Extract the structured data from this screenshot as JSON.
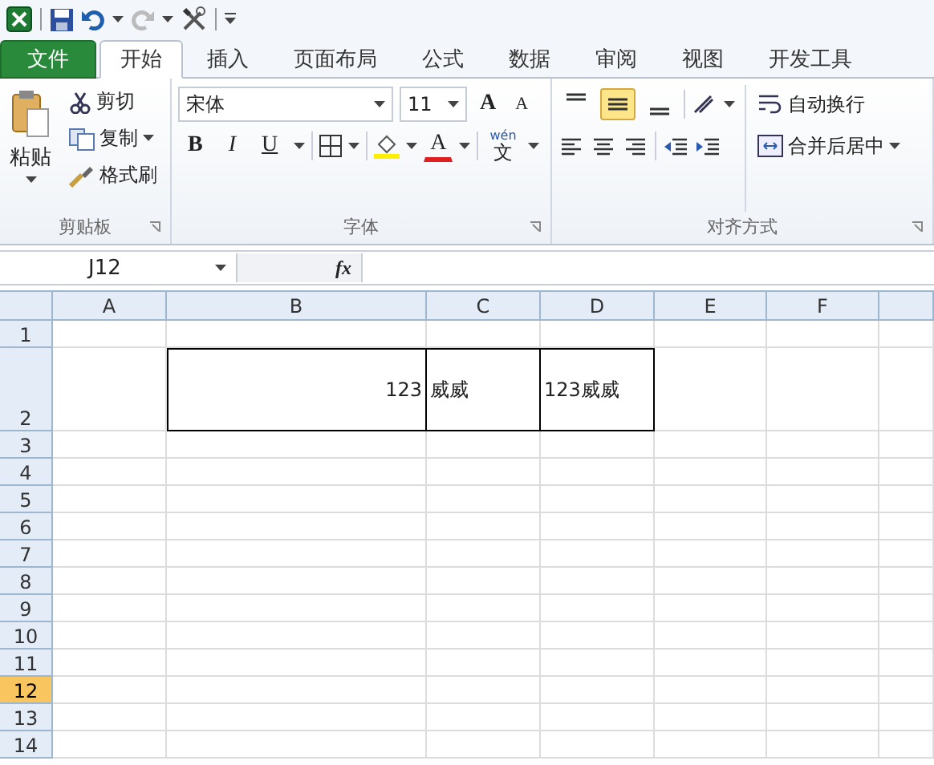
{
  "quick_access": {
    "undo": {
      "disabled": false
    },
    "redo": {
      "disabled": true
    }
  },
  "tabs": [
    {
      "label": "文件",
      "kind": "file",
      "selected": false
    },
    {
      "label": "开始",
      "kind": "tab",
      "selected": true
    },
    {
      "label": "插入",
      "kind": "tab",
      "selected": false
    },
    {
      "label": "页面布局",
      "kind": "tab",
      "selected": false
    },
    {
      "label": "公式",
      "kind": "tab",
      "selected": false
    },
    {
      "label": "数据",
      "kind": "tab",
      "selected": false
    },
    {
      "label": "审阅",
      "kind": "tab",
      "selected": false
    },
    {
      "label": "视图",
      "kind": "tab",
      "selected": false
    },
    {
      "label": "开发工具",
      "kind": "tab",
      "selected": false
    }
  ],
  "ribbon": {
    "clipboard": {
      "paste": "粘贴",
      "cut": "剪切",
      "copy": "复制",
      "format_painter": "格式刷",
      "label": "剪贴板"
    },
    "font": {
      "font_name": "宋体",
      "font_size": "11",
      "grow": "A",
      "shrink": "A",
      "bold": "B",
      "italic": "I",
      "underline": "U",
      "font_color": "A",
      "phonetic_ruby": "wén",
      "phonetic": "文",
      "label": "字体"
    },
    "alignment": {
      "vertical": [
        {
          "kind": "top",
          "selected": false
        },
        {
          "kind": "middle",
          "selected": true
        },
        {
          "kind": "bottom",
          "selected": false
        }
      ],
      "wrap_text": "自动换行",
      "merge_center": "合并后居中",
      "label": "对齐方式"
    }
  },
  "formula_bar": {
    "name_box": "J12",
    "fx": "fx"
  },
  "sheet": {
    "columns": [
      {
        "label": "A",
        "selected": false
      },
      {
        "label": "B",
        "selected": false
      },
      {
        "label": "C",
        "selected": false
      },
      {
        "label": "D",
        "selected": false
      },
      {
        "label": "E",
        "selected": false
      },
      {
        "label": "F",
        "selected": false
      }
    ],
    "rows": [
      {
        "label": "1",
        "selected": false
      },
      {
        "label": "2",
        "selected": false,
        "kind": "tall",
        "cells": [
          {},
          {
            "text": "123",
            "kind": "number",
            "bordered": true
          },
          {
            "text": "威威",
            "kind": "text",
            "bordered": true
          },
          {
            "text": "123威威",
            "kind": "text",
            "bordered": true
          },
          {},
          {},
          {}
        ]
      },
      {
        "label": "3",
        "selected": false
      },
      {
        "label": "4",
        "selected": false
      },
      {
        "label": "5",
        "selected": false
      },
      {
        "label": "6",
        "selected": false
      },
      {
        "label": "7",
        "selected": false
      },
      {
        "label": "8",
        "selected": false
      },
      {
        "label": "9",
        "selected": false
      },
      {
        "label": "10",
        "selected": false
      },
      {
        "label": "11",
        "selected": false
      },
      {
        "label": "12",
        "selected": true
      },
      {
        "label": "13",
        "selected": false
      },
      {
        "label": "14",
        "selected": false
      }
    ]
  }
}
